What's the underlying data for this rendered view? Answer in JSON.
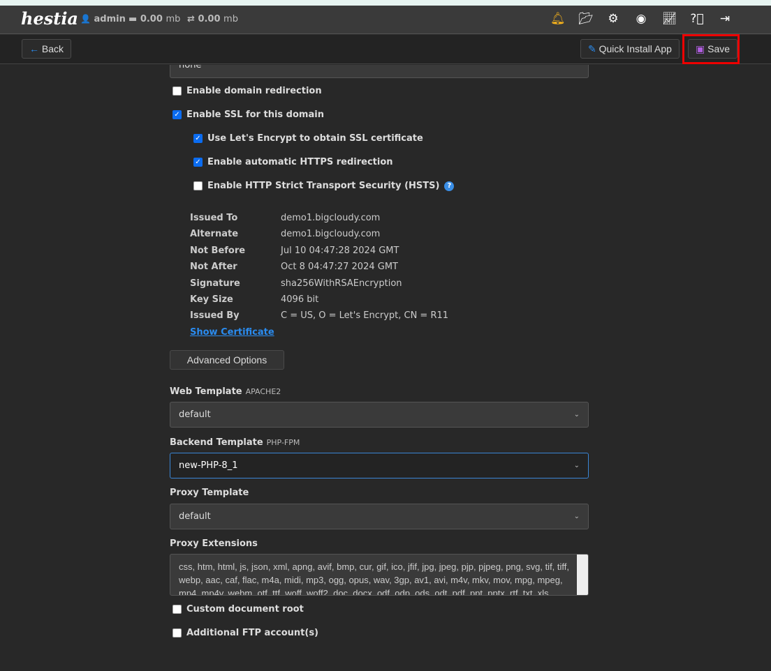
{
  "topbar": {
    "logo": "hestia",
    "user": "admin",
    "disk_value": "0.00",
    "disk_unit": "mb",
    "bandwidth_value": "0.00",
    "bandwidth_unit": "mb",
    "icons": [
      "bell-icon",
      "folder-open-icon",
      "gear-icon",
      "user-circle-icon",
      "chart-line-icon",
      "question-circle-icon",
      "logout-icon"
    ]
  },
  "toolbar": {
    "back": "Back",
    "quick_install": "Quick Install App",
    "save": "Save"
  },
  "form": {
    "partial_select": "none",
    "redirect": "Enable domain redirection",
    "ssl": "Enable SSL for this domain",
    "letsencrypt": "Use Let's Encrypt to obtain SSL certificate",
    "https_redirect": "Enable automatic HTTPS redirection",
    "hsts": "Enable HTTP Strict Transport Security (HSTS)",
    "cert": [
      {
        "k": "Issued To",
        "v": "demo1.bigcloudy.com"
      },
      {
        "k": "Alternate",
        "v": "demo1.bigcloudy.com"
      },
      {
        "k": "Not Before",
        "v": "Jul 10 04:47:28 2024 GMT"
      },
      {
        "k": "Not After",
        "v": "Oct 8 04:47:27 2024 GMT"
      },
      {
        "k": "Signature",
        "v": "sha256WithRSAEncryption"
      },
      {
        "k": "Key Size",
        "v": "4096 bit"
      },
      {
        "k": "Issued By",
        "v": "C = US, O = Let's Encrypt, CN = R11"
      }
    ],
    "show_cert": "Show Certificate",
    "advanced": "Advanced Options",
    "web_template_label": "Web Template",
    "web_template_tag": "APACHE2",
    "web_template": "default",
    "backend_label": "Backend Template",
    "backend_tag": "PHP-FPM",
    "backend": "new-PHP-8_1",
    "proxy_label": "Proxy Template",
    "proxy": "default",
    "ext_label": "Proxy Extensions",
    "extensions": "css, htm, html, js, json, xml, apng, avif, bmp, cur, gif, ico, jfif, jpg, jpeg, pjp, pjpeg, png, svg, tif, tiff, webp, aac, caf, flac, m4a, midi, mp3, ogg, opus, wav, 3gp, av1, avi, m4v, mkv, mov, mpg, mpeg, mp4, mp4v, webm, otf, ttf, woff, woff2, doc, docx, odf, odp, ods, odt, pdf, ppt, pptx, rtf, txt, xls",
    "custom_root": "Custom document root",
    "ftp": "Additional FTP account(s)"
  }
}
